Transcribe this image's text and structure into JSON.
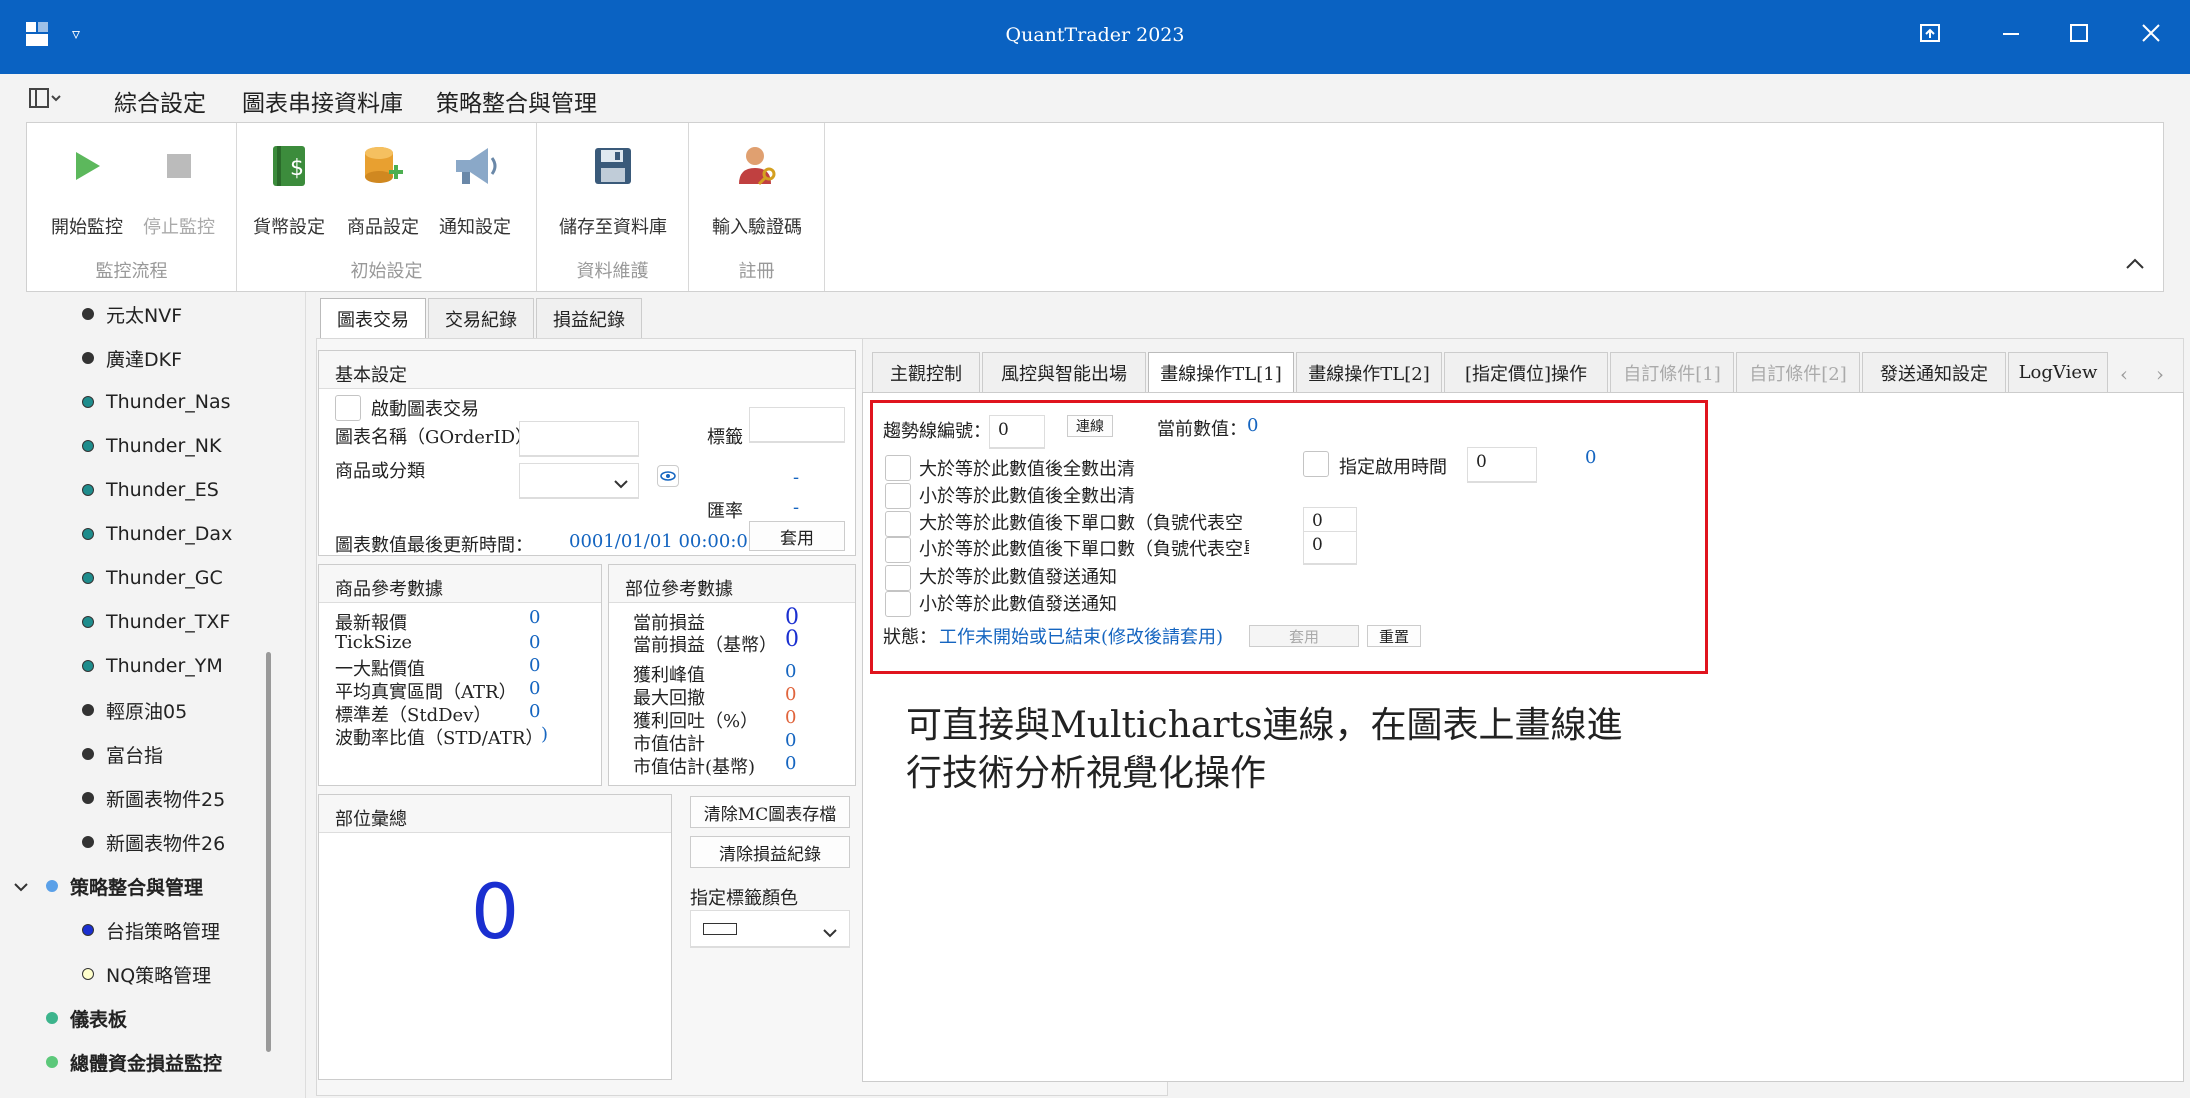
{
  "app": {
    "title": "QuantTrader 2023"
  },
  "menu": {
    "items": [
      "綜合設定",
      "圖表串接資料庫",
      "策略整合與管理"
    ]
  },
  "ribbon": {
    "groups": [
      {
        "label": "監控流程",
        "buttons": [
          "開始監控",
          "停止監控"
        ]
      },
      {
        "label": "初始設定",
        "buttons": [
          "貨幣設定",
          "商品設定",
          "通知設定"
        ]
      },
      {
        "label": "資料維護",
        "buttons": [
          "儲存至資料庫"
        ]
      },
      {
        "label": "註冊",
        "buttons": [
          "輸入驗證碼"
        ]
      }
    ]
  },
  "sidebar": {
    "items": [
      {
        "label": "元太NVF",
        "color": "#333333"
      },
      {
        "label": "廣達DKF",
        "color": "#333333"
      },
      {
        "label": "Thunder_Nas",
        "color": "#1e8c8c"
      },
      {
        "label": "Thunder_NK",
        "color": "#1e8c8c"
      },
      {
        "label": "Thunder_ES",
        "color": "#1e8c8c"
      },
      {
        "label": "Thunder_Dax",
        "color": "#1e8c8c"
      },
      {
        "label": "Thunder_GC",
        "color": "#1e8c8c"
      },
      {
        "label": "Thunder_TXF",
        "color": "#1e8c8c"
      },
      {
        "label": "Thunder_YM",
        "color": "#1e8c8c"
      },
      {
        "label": "輕原油05",
        "color": "#333333"
      },
      {
        "label": "富台指",
        "color": "#333333"
      },
      {
        "label": "新圖表物件25",
        "color": "#333333"
      },
      {
        "label": "新圖表物件26",
        "color": "#333333"
      }
    ],
    "group": {
      "label": "策略整合與管理",
      "color": "#5aa0e8"
    },
    "group_children": [
      {
        "label": "台指策略管理",
        "color": "#1a2fd0"
      },
      {
        "label": "NQ策略管理",
        "color": "#ffffcc"
      }
    ],
    "top_items": [
      {
        "label": "儀表板",
        "color": "#3cb48c"
      },
      {
        "label": "總體資金損益監控",
        "color": "#5cc87a"
      }
    ]
  },
  "main_tabs": [
    "圖表交易",
    "交易紀錄",
    "損益紀錄"
  ],
  "basic": {
    "header": "基本設定",
    "enable_chart_trade": "啟動圖表交易",
    "chart_name_label": "圖表名稱（GOrderID）",
    "tag_label": "標籤",
    "product_label": "商品或分類",
    "dash1": "-",
    "rate_label": "匯率",
    "dash2": "-",
    "update_label": "圖表數值最後更新時間：",
    "update_value": "0001/01/01 00:00:00",
    "apply": "套用"
  },
  "product_ref": {
    "header": "商品參考數據",
    "rows": [
      {
        "label": "最新報價",
        "value": "0"
      },
      {
        "label": "TickSize",
        "value": "0"
      },
      {
        "label": "一大點價值",
        "value": "0"
      },
      {
        "label": "平均真實區間（ATR）",
        "value": "0"
      },
      {
        "label": "標準差（StdDev）",
        "value": "0"
      },
      {
        "label": "波動率比值（STD/ATR）",
        "value": ")"
      }
    ]
  },
  "position_ref": {
    "header": "部位參考數據",
    "rows": [
      {
        "label": "當前損益",
        "value": "0"
      },
      {
        "label": "當前損益（基幣）",
        "value": "0"
      },
      {
        "label": "獲利峰值",
        "value": "0"
      },
      {
        "label": "最大回撤",
        "value": "0"
      },
      {
        "label": "獲利回吐（%）",
        "value": "0"
      },
      {
        "label": "市值估計",
        "value": "0"
      },
      {
        "label": "市值估計(基幣)",
        "value": "0"
      }
    ]
  },
  "summary": {
    "header": "部位彙總",
    "value": "0"
  },
  "actions": {
    "clear_mc": "清除MC圖表存檔",
    "clear_pnl": "清除損益紀錄",
    "tag_color_label": "指定標籤顏色"
  },
  "right_tabs": [
    "主觀控制",
    "風控與智能出場",
    "畫線操作TL[1]",
    "畫線操作TL[2]",
    "[指定價位]操作",
    "自訂條件[1]",
    "自訂條件[2]",
    "發送通知設定",
    "LogView"
  ],
  "tl": {
    "trend_id_label": "趨勢線編號：",
    "trend_id_value": "0",
    "connect": "連線",
    "current_label": "當前數值：",
    "current_value": "0",
    "cond1": "大於等於此數值後全數出清",
    "cond2": "小於等於此數值後全數出清",
    "cond3": "大於等於此數值後下單口數（負號代表空",
    "cond4": "小於等於此數值後下單口數（負號代表空單",
    "cond5": "大於等於此數值發送通知",
    "cond6": "小於等於此數值發送通知",
    "enable_time_label": "指定啟用時間",
    "enable_time_value": "0",
    "right_value": "0",
    "qty1": "0",
    "qty2": "0",
    "status_label": "狀態：",
    "status_value": "工作未開始或已結束(修改後請套用)",
    "apply": "套用",
    "reset": "重置"
  },
  "note": {
    "line1": "可直接與Multicharts連線，在圖表上畫線進",
    "line2": "行技術分析視覺化操作"
  },
  "colors": {
    "titlebar": "#0a62c2",
    "link": "#1565c0",
    "highlight": "#e0141e"
  }
}
